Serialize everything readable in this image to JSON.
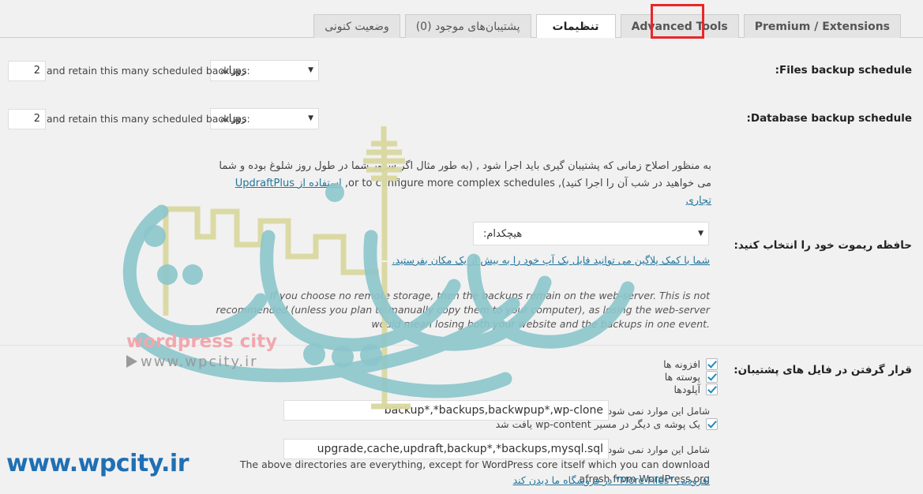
{
  "tabs": [
    {
      "label": "Premium / Extensions",
      "dir": "ltr",
      "active": false
    },
    {
      "label": "Advanced Tools",
      "dir": "ltr",
      "active": false
    },
    {
      "label": "تنظیمات",
      "dir": "rtl",
      "active": true,
      "highlighted": true
    },
    {
      "label": "پشتیبان‌های موجود (0)",
      "dir": "rtl",
      "active": false
    },
    {
      "label": "وضعیت کنونی",
      "dir": "rtl",
      "active": false
    }
  ],
  "colors": {
    "accent_red": "#e8262a",
    "link_blue": "#21759b",
    "page_bg": "#f1f1f1",
    "tab_inactive_bg": "#e4e4e4",
    "tab_active_bg": "#ffffff",
    "watermark_url_blue": "#1f6fb4",
    "watermark_teal": "#8cc6cc",
    "watermark_khaki": "#d9d8a0",
    "watermark_pink": "#f0a8ae",
    "checkbox_check": "#1e8cbe"
  },
  "files_schedule": {
    "label": "Files backup schedule:",
    "select_value": "روزانه",
    "retain_text": "and retain this many scheduled backups:",
    "retain_value": "2"
  },
  "database_schedule": {
    "label": "Database backup schedule:",
    "select_value": "روزانه",
    "retain_text": "and retain this many scheduled backups:",
    "retain_value": "2"
  },
  "schedule_note": {
    "line1_rtl": "به منظور اصلاح زمانی که پشتیبان گیری باید اجرا شود , (به طور مثال اگر سرور شما در طول روز شلوغ بوده و شما",
    "line2_rtl_start": "می خواهید در شب آن را اجرا کنید),",
    "line2_ltr": "or to configure more complex schedules,",
    "line2_link": "استفاده از UpdraftPlus تجاری"
  },
  "remote_storage": {
    "label": "حافظه ریموت خود را انتخاب کنید:",
    "select_value": "هیچکدام:",
    "link": "شما با کمک پلاگین می توانید فایل بک آپ خود را به بیش از یک مکان بفرستید.",
    "note_italic": "If you choose no remote storage, then the backups remain on the web-server. This is not recommended (unless you plan to manually copy them to your computer), as losing the web-server would mean losing both your website and the backups in one event."
  },
  "include_files": {
    "label": "قرار گرفتن در فایل های پشتیبان:",
    "checkboxes": [
      {
        "label": "افزونه ها",
        "checked": true
      },
      {
        "label": "پوسته ها",
        "checked": true
      },
      {
        "label": "آپلودها",
        "checked": true
      }
    ],
    "exclude_label_1": "شامل این موارد نمی شود:",
    "exclude_value_1": "backup*,*backups,backwpup*,wp-clone",
    "other_dir_checkbox": {
      "label": "یک پوشه ی دیگر در مسیر wp-content یافت شد",
      "checked": true
    },
    "exclude_label_2": "شامل این موارد نمی شود:",
    "exclude_value_2": "upgrade,cache,updraft,backup*,*backups,mysql.sql",
    "footer_note": "The above directories are everything, except for WordPress core itself which you can download afresh from WordPress.org",
    "footer_link": "افزودنی \"More Files\" در فروشگاه ما دیدن کند"
  },
  "watermark": {
    "url_text": "www.wpcity.ir",
    "brand_line1": "wordpress city",
    "brand_line2": "www.wpcity.ir"
  }
}
